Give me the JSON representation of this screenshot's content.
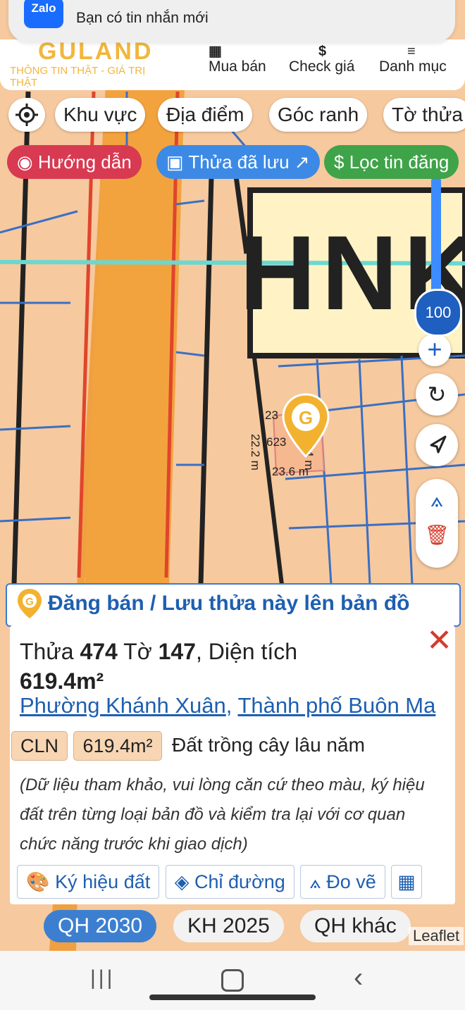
{
  "notification": {
    "app": "Zalo",
    "message": "Bạn có tin nhắn mới"
  },
  "header": {
    "logo": "GULAND",
    "tagline": "THÔNG TIN THẬT - GIÁ TRỊ THẬT",
    "nav": [
      {
        "label": "Mua bán",
        "icon": "listing-icon"
      },
      {
        "label": "Check giá",
        "icon": "dollar-icon"
      },
      {
        "label": "Danh mục",
        "icon": "menu-icon"
      }
    ]
  },
  "filters": [
    "Khu vực",
    "Địa điểm",
    "Góc ranh",
    "Tờ thửa"
  ],
  "pills": {
    "guide": "Hướng dẫn",
    "saved": "Thửa đã lưu ↗",
    "filter": "Lọc tin đăng"
  },
  "map": {
    "zoom_level": "100",
    "zone_label": "HNK",
    "measurements": {
      "top": "23",
      "left": "22.2 m",
      "right": "7.4 m",
      "bottom": "23.6 m",
      "parcel_no": "623"
    },
    "attribution": "Leaflet",
    "colors": {
      "land": "#f6c99e",
      "road": "#f0a040",
      "zone": "#fff5c8",
      "accent": "#1e5fc0"
    }
  },
  "post_banner": "Đăng bán / Lưu thửa này lên bản đồ",
  "parcel": {
    "plot_label": "Thửa",
    "plot_no": "474",
    "sheet_label": "Tờ",
    "sheet_no": "147",
    "area_label": ", Diện tích",
    "area": "619.4m²",
    "ward": "Phường Khánh Xuân",
    "separator": ",",
    "city": "Thành phố Buôn Ma",
    "land_code": "CLN",
    "area_tag": "619.4m²",
    "land_type": "Đất trồng cây lâu năm",
    "note": "(Dữ liệu tham khảo, vui lòng căn cứ theo màu, ký hiệu đất trên từng loại bản đồ và kiểm tra lại với cơ quan chức năng trước khi giao dịch)"
  },
  "actions": [
    "Ký hiệu đất",
    "Chỉ đường",
    "Đo vẽ"
  ],
  "layers": [
    "QH 2030",
    "KH 2025",
    "QH khác"
  ]
}
